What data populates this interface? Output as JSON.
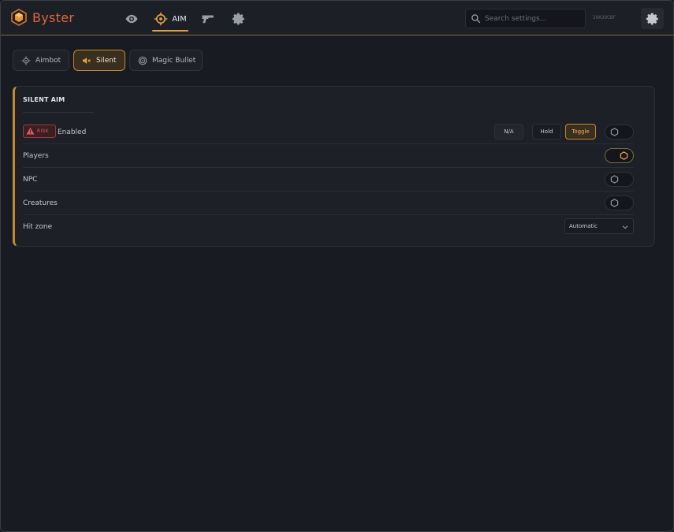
{
  "app": {
    "title": "Byster",
    "hwid": "20A39CBF"
  },
  "nav": {
    "items": [
      {
        "id": "visuals",
        "icon": "eye-icon"
      },
      {
        "id": "aim",
        "label": "AIM",
        "icon": "crosshair-icon",
        "active": true
      },
      {
        "id": "weapons",
        "icon": "gun-icon"
      },
      {
        "id": "misc",
        "icon": "gear-icon"
      }
    ]
  },
  "search": {
    "placeholder": "Search settings..."
  },
  "tabs": [
    {
      "label": "Aimbot",
      "icon": "crosshair-icon"
    },
    {
      "label": "Silent",
      "icon": "mute-icon",
      "active": true
    },
    {
      "label": "Magic Bullet",
      "icon": "target-icon"
    }
  ],
  "panel": {
    "title": "SILENT AIM",
    "rows": [
      {
        "label": "Enabled",
        "risk": "RISK",
        "keys": [
          "N/A",
          "Hold",
          "Toggle"
        ],
        "active_key": "Toggle",
        "toggle": false
      },
      {
        "label": "Players",
        "toggle": true
      },
      {
        "label": "NPC",
        "toggle": false
      },
      {
        "label": "Creatures",
        "toggle": false
      },
      {
        "label": "Hit zone",
        "select": "Automatic"
      }
    ]
  },
  "colors": {
    "accent": "#e3a33a",
    "brand": "#e0673a",
    "risk": "#d85b5f",
    "background": "#181b22"
  }
}
